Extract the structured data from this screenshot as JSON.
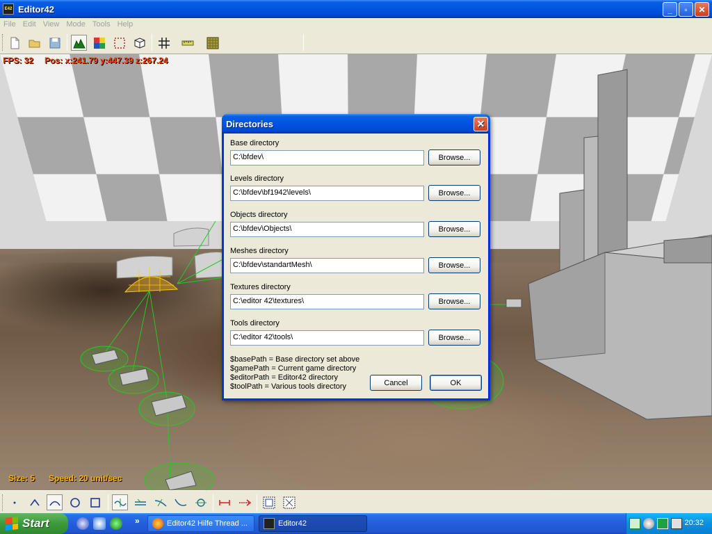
{
  "window": {
    "title": "Editor42",
    "buttons": {
      "minimize": "_",
      "maximize": "▫",
      "close": "✕"
    }
  },
  "menu": [
    "File",
    "Edit",
    "View",
    "Mode",
    "Tools",
    "Help"
  ],
  "toolbar_icons": [
    "new-file-icon",
    "open-folder-icon",
    "save-icon",
    "terrain-icon",
    "texture-paint-icon",
    "selection-icon",
    "object-cube-icon",
    "grid-icon",
    "ruler-icon",
    "tile-grid-icon"
  ],
  "hud": {
    "fps": "FPS: 32",
    "pos": "Pos: x:241.79  y:447.39  z:267.24",
    "size": "Size: 5",
    "speed": "Speed: 20 unit/sec"
  },
  "dialog": {
    "title": "Directories",
    "close": "✕",
    "browse_label": "Browse...",
    "fields": [
      {
        "label": "Base directory",
        "value": "C:\\bfdev\\"
      },
      {
        "label": "Levels directory",
        "value": "C:\\bfdev\\bf1942\\levels\\"
      },
      {
        "label": "Objects directory",
        "value": "C:\\bfdev\\Objects\\"
      },
      {
        "label": "Meshes directory",
        "value": "C:\\bfdev\\standartMesh\\"
      },
      {
        "label": "Textures directory",
        "value": "C:\\editor 42\\textures\\"
      },
      {
        "label": "Tools directory",
        "value": "C:\\editor 42\\tools\\"
      }
    ],
    "help": [
      "$basePath = Base directory set above",
      "$gamePath = Current game directory",
      "$editorPath = Editor42 directory",
      "$toolPath = Various tools directory"
    ],
    "cancel_label": "Cancel",
    "ok_label": "OK"
  },
  "bottom_toolbar_icons": [
    "point-icon",
    "peak-icon",
    "curve-icon",
    "circle-icon",
    "square-icon",
    "path-smooth-icon",
    "path-add-icon",
    "path-split-icon",
    "path-curve-icon",
    "path-node-icon",
    "line-endpoints-icon",
    "line-arrow-icon",
    "pattern-select-icon",
    "pattern-deselect-icon"
  ],
  "taskbar": {
    "start_label": "Start",
    "tasks": [
      {
        "label": "Editor42 Hilfe Thread ...",
        "active": false
      },
      {
        "label": "Editor42",
        "active": true
      }
    ],
    "clock": "20:32",
    "chevron": "»"
  },
  "colors": {
    "xp_blue": "#0054e3",
    "hud_red": "#ff3b00",
    "hud_orange": "#ffb000",
    "wire_green": "#22cc22",
    "wire_yellow": "#ffcc00"
  }
}
